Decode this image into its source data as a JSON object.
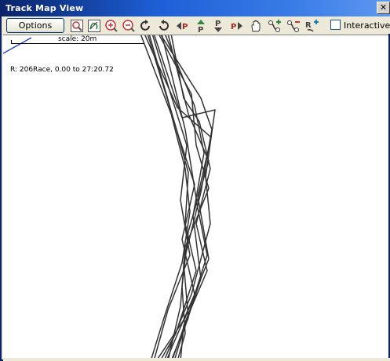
{
  "window": {
    "title": "Track Map View",
    "close_glyph": "✕"
  },
  "toolbar": {
    "options_label": "Options",
    "interactive_label": "Interactive M",
    "interactive_checked": false,
    "tools": [
      {
        "name": "zoom-to-fit-icon"
      },
      {
        "name": "highlight-section-icon"
      },
      {
        "name": "zoom-in-icon"
      },
      {
        "name": "zoom-out-icon"
      },
      {
        "name": "rotate-clockwise-icon"
      },
      {
        "name": "rotate-counterclockwise-icon"
      },
      {
        "name": "move-left-icon"
      },
      {
        "name": "move-up-icon"
      },
      {
        "name": "move-down-icon"
      },
      {
        "name": "move-right-icon"
      },
      {
        "name": "pan-hand-icon"
      },
      {
        "name": "add-marker-icon"
      },
      {
        "name": "remove-marker-icon"
      },
      {
        "name": "add-reference-icon"
      }
    ]
  },
  "map": {
    "scale_label": "scale: 20m",
    "run_info": "R: 206Race, 0.00 to 27:20.72",
    "colors": {
      "track": "#333333",
      "start_line": "#1f3fd0"
    }
  }
}
